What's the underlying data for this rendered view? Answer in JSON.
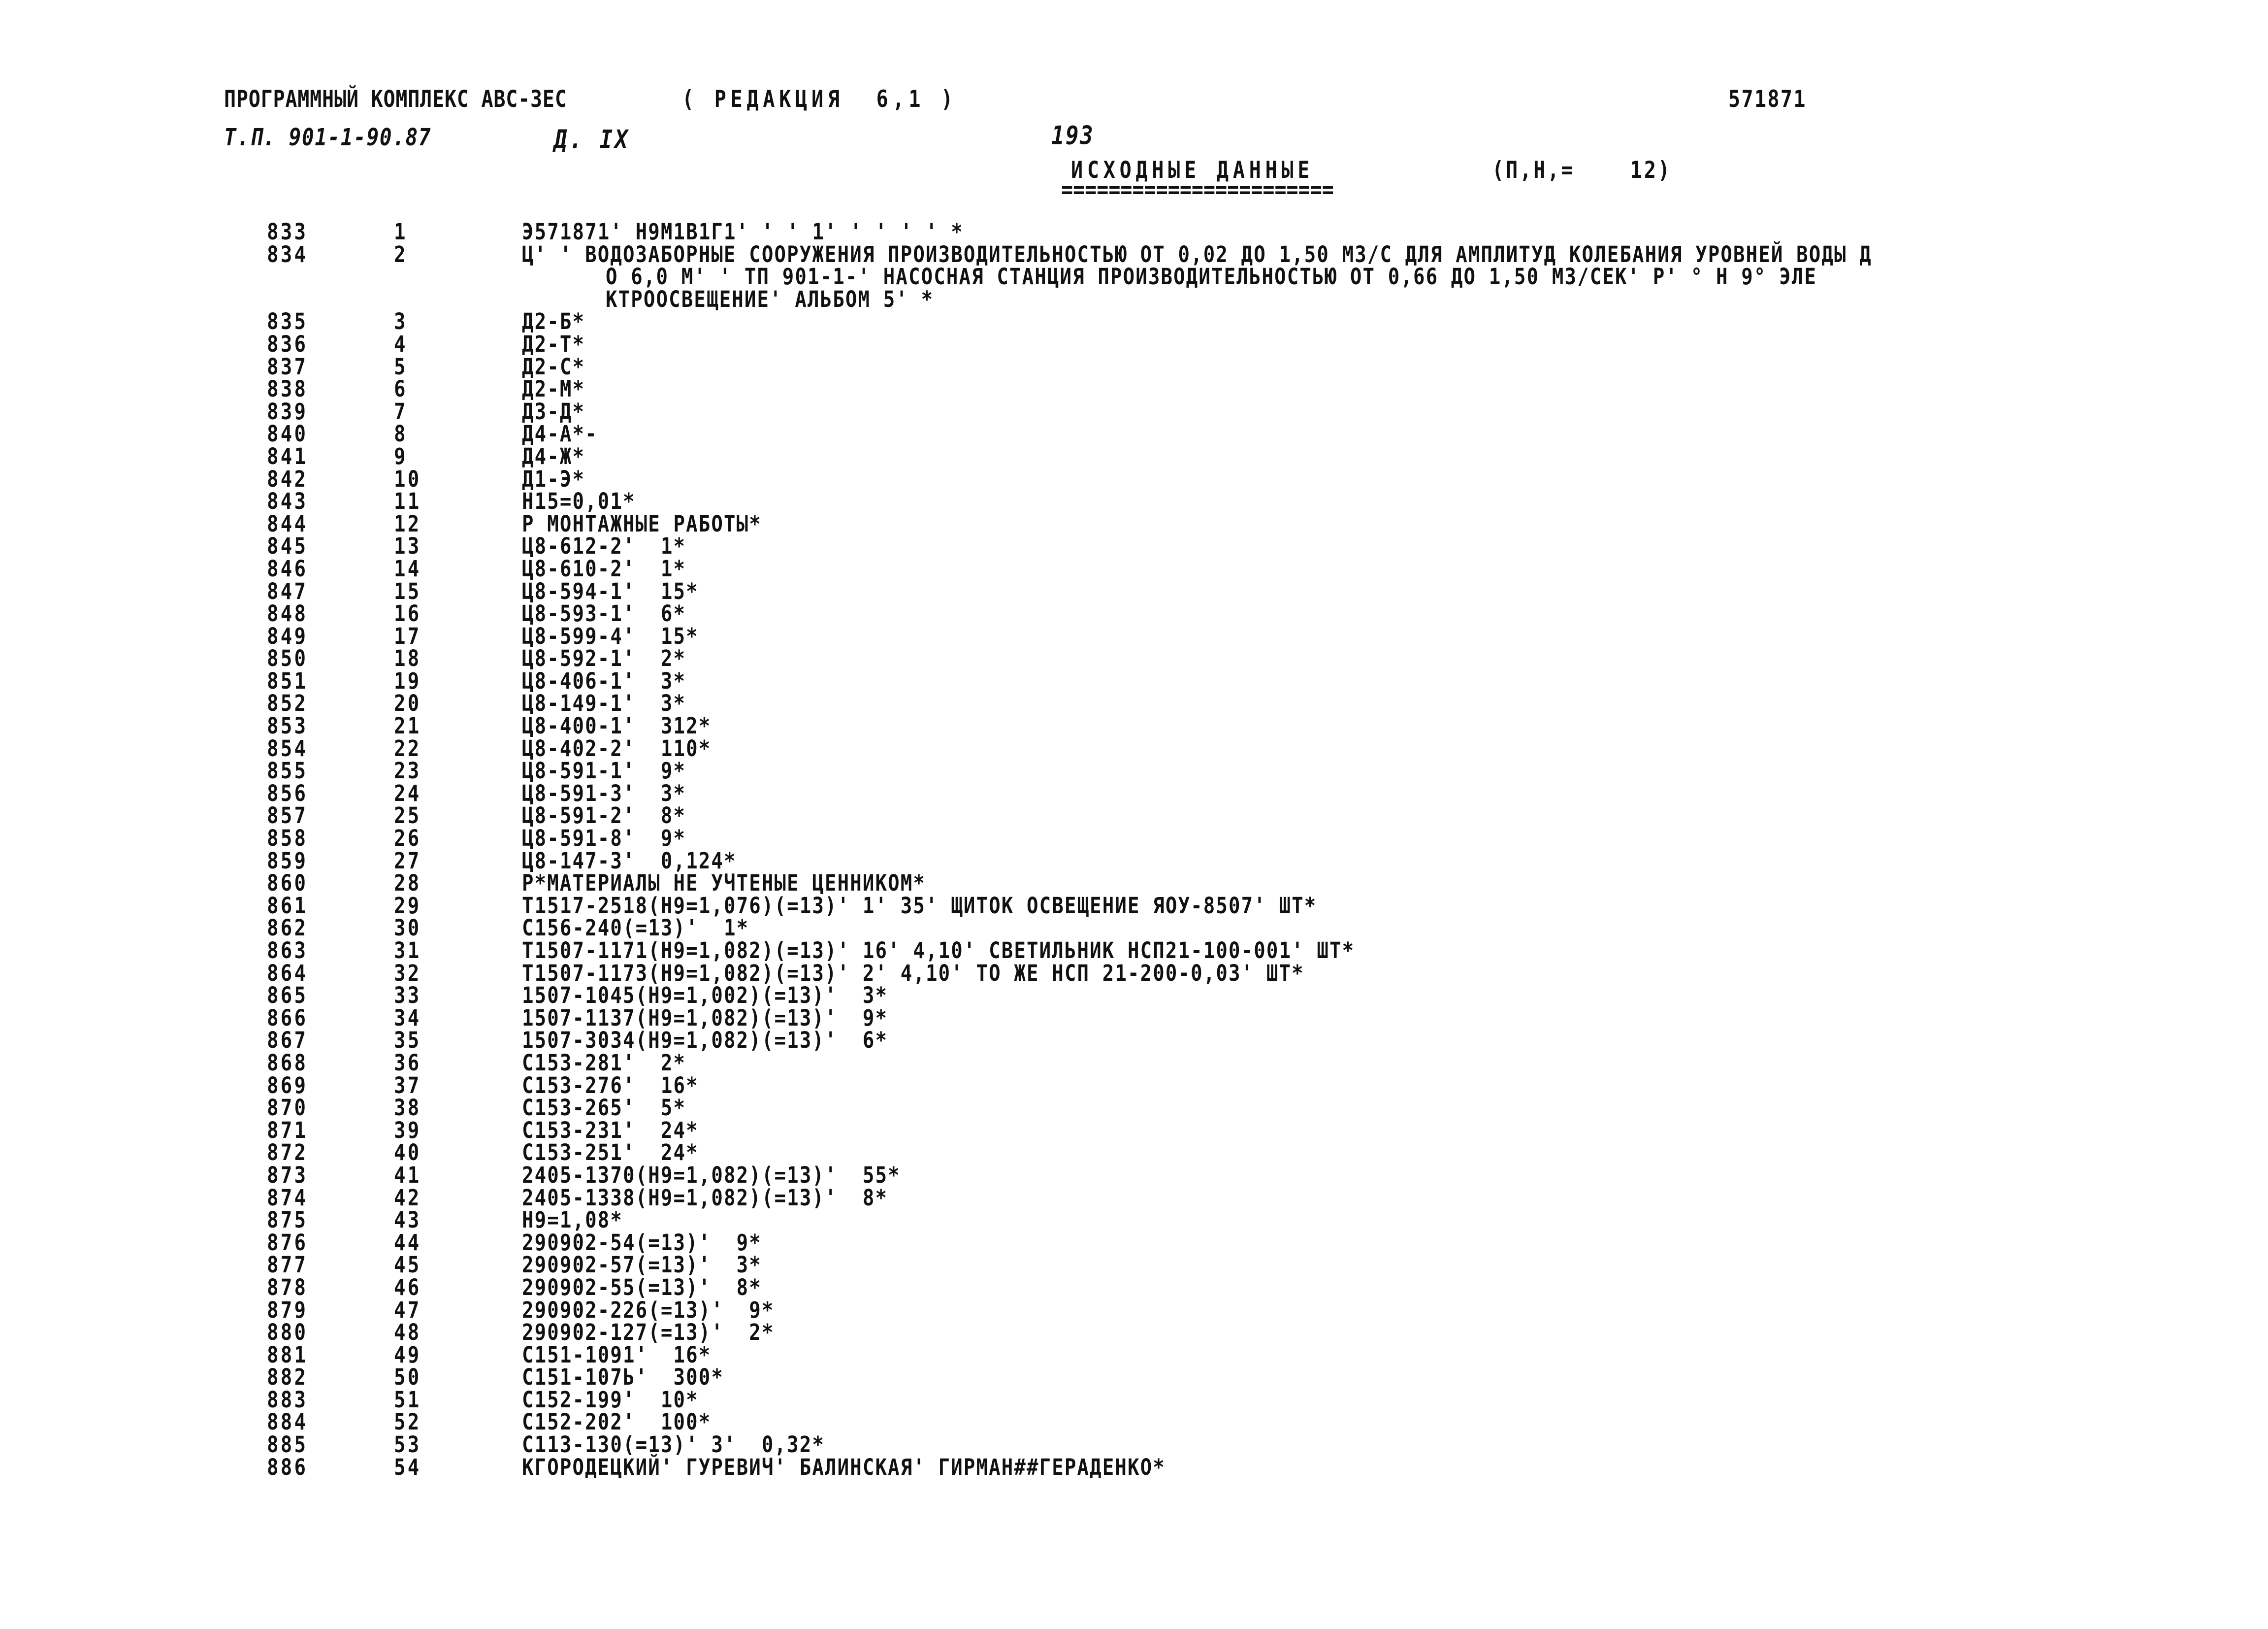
{
  "header": {
    "program_complex": "ПРОГРАММНЫЙ КОМПЛЕКС АВС-3ЕС",
    "revision": "( РЕДАКЦИЯ  6,1 )",
    "tp_number": "Т.П. 901-1-90.87",
    "album_mark": "Д. IX",
    "page_number": "193",
    "doc_number": "571871",
    "title": "ИСХОДНЫЕ ДАННЫЕ",
    "title_rule": "=======================",
    "record_count": "(П,Н,=    12)"
  },
  "listing": {
    "rows": [
      {
        "a": "833",
        "b": "1",
        "c": "Э571871' Н9М1В1Г1' ' ' 1' ' ' ' ' *"
      },
      {
        "a": "834",
        "b": "2",
        "c": "Ц' ' ВОДОЗАБОРНЫЕ СООРУЖЕНИЯ ПРОИЗВОДИТЕЛЬНОСТЬЮ ОТ 0,02 ДО 1,50 М3/С ДЛЯ АМПЛИТУД КОЛЕБАНИЯ УРОВНЕЙ ВОДЫ Д"
      },
      {
        "a": "",
        "b": "",
        "c": "О 6,0 М' ' ТП 901-1-' НАСОСНАЯ СТАНЦИЯ ПРОИЗВОДИТЕЛЬНОСТЬЮ ОТ 0,66 ДО 1,50 М3/СЕК' Р' ° Н 9° ЭЛЕ",
        "cont": true
      },
      {
        "a": "",
        "b": "",
        "c": "КТРООСВЕЩЕНИЕ' АЛЬБОМ 5' *",
        "cont": true
      },
      {
        "a": "835",
        "b": "3",
        "c": "Д2-Б*"
      },
      {
        "a": "836",
        "b": "4",
        "c": "Д2-Т*"
      },
      {
        "a": "837",
        "b": "5",
        "c": "Д2-С*"
      },
      {
        "a": "838",
        "b": "6",
        "c": "Д2-М*"
      },
      {
        "a": "839",
        "b": "7",
        "c": "Д3-Д*"
      },
      {
        "a": "840",
        "b": "8",
        "c": "Д4-А*-"
      },
      {
        "a": "841",
        "b": "9",
        "c": "Д4-Ж*"
      },
      {
        "a": "842",
        "b": "10",
        "c": "Д1-Э*"
      },
      {
        "a": "843",
        "b": "11",
        "c": "Н15=0,01*"
      },
      {
        "a": "844",
        "b": "12",
        "c": "Р МОНТАЖНЫЕ РАБОТЫ*"
      },
      {
        "a": "845",
        "b": "13",
        "c": "Ц8-612-2'  1*"
      },
      {
        "a": "846",
        "b": "14",
        "c": "Ц8-610-2'  1*"
      },
      {
        "a": "847",
        "b": "15",
        "c": "Ц8-594-1'  15*"
      },
      {
        "a": "848",
        "b": "16",
        "c": "Ц8-593-1'  6*"
      },
      {
        "a": "849",
        "b": "17",
        "c": "Ц8-599-4'  15*"
      },
      {
        "a": "850",
        "b": "18",
        "c": "Ц8-592-1'  2*"
      },
      {
        "a": "851",
        "b": "19",
        "c": "Ц8-406-1'  3*"
      },
      {
        "a": "852",
        "b": "20",
        "c": "Ц8-149-1'  3*"
      },
      {
        "a": "853",
        "b": "21",
        "c": "Ц8-400-1'  312*"
      },
      {
        "a": "854",
        "b": "22",
        "c": "Ц8-402-2'  110*"
      },
      {
        "a": "855",
        "b": "23",
        "c": "Ц8-591-1'  9*"
      },
      {
        "a": "856",
        "b": "24",
        "c": "Ц8-591-3'  3*"
      },
      {
        "a": "857",
        "b": "25",
        "c": "Ц8-591-2'  8*"
      },
      {
        "a": "858",
        "b": "26",
        "c": "Ц8-591-8'  9*"
      },
      {
        "a": "859",
        "b": "27",
        "c": "Ц8-147-3'  0,124*"
      },
      {
        "a": "860",
        "b": "28",
        "c": "Р*МАТЕРИАЛЫ НЕ УЧТЕНЫЕ ЦЕННИКОМ*"
      },
      {
        "a": "861",
        "b": "29",
        "c": "Т1517-2518(Н9=1,076)(=13)' 1' 35' ЩИТОК ОСВЕЩЕНИЕ ЯОУ-8507' ШТ*"
      },
      {
        "a": "862",
        "b": "30",
        "c": "С156-240(=13)'  1*"
      },
      {
        "a": "863",
        "b": "31",
        "c": "Т1507-1171(Н9=1,082)(=13)' 16' 4,10' СВЕТИЛЬНИК НСП21-100-001' ШТ*"
      },
      {
        "a": "864",
        "b": "32",
        "c": "Т1507-1173(Н9=1,082)(=13)' 2' 4,10' ТО ЖЕ НСП 21-200-0,03' ШТ*"
      },
      {
        "a": "865",
        "b": "33",
        "c": "1507-1045(Н9=1,002)(=13)'  3*"
      },
      {
        "a": "866",
        "b": "34",
        "c": "1507-1137(Н9=1,082)(=13)'  9*"
      },
      {
        "a": "867",
        "b": "35",
        "c": "1507-3034(Н9=1,082)(=13)'  6*"
      },
      {
        "a": "868",
        "b": "36",
        "c": "С153-281'  2*"
      },
      {
        "a": "869",
        "b": "37",
        "c": "С153-276'  16*"
      },
      {
        "a": "870",
        "b": "38",
        "c": "С153-265'  5*"
      },
      {
        "a": "871",
        "b": "39",
        "c": "С153-231'  24*"
      },
      {
        "a": "872",
        "b": "40",
        "c": "С153-251'  24*"
      },
      {
        "a": "873",
        "b": "41",
        "c": "2405-1370(Н9=1,082)(=13)'  55*"
      },
      {
        "a": "874",
        "b": "42",
        "c": "2405-1338(Н9=1,082)(=13)'  8*"
      },
      {
        "a": "875",
        "b": "43",
        "c": "Н9=1,08*"
      },
      {
        "a": "876",
        "b": "44",
        "c": "290902-54(=13)'  9*"
      },
      {
        "a": "877",
        "b": "45",
        "c": "290902-57(=13)'  3*"
      },
      {
        "a": "878",
        "b": "46",
        "c": "290902-55(=13)'  8*"
      },
      {
        "a": "879",
        "b": "47",
        "c": "290902-226(=13)'  9*"
      },
      {
        "a": "880",
        "b": "48",
        "c": "290902-127(=13)'  2*"
      },
      {
        "a": "881",
        "b": "49",
        "c": "С151-1091'  16*"
      },
      {
        "a": "882",
        "b": "50",
        "c": "С151-107Ь'  300*"
      },
      {
        "a": "883",
        "b": "51",
        "c": "С152-199'  10*"
      },
      {
        "a": "884",
        "b": "52",
        "c": "С152-202'  100*"
      },
      {
        "a": "885",
        "b": "53",
        "c": "С113-130(=13)' 3'  0,32*"
      },
      {
        "a": "886",
        "b": "54",
        "c": "КГОРОДЕЦКИЙ' ГУРЕВИЧ' БАЛИНСКАЯ' ГИРМАН##ГЕРАДЕНКО*"
      }
    ]
  }
}
